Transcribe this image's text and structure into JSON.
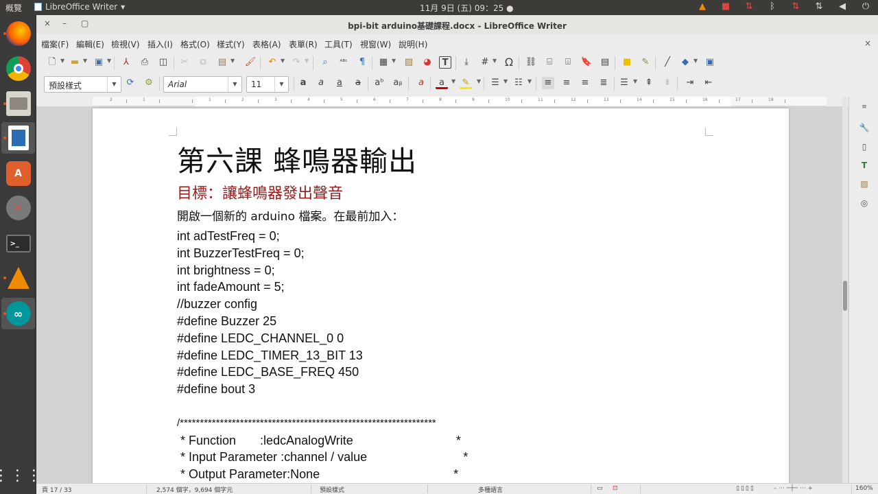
{
  "top_panel": {
    "activities": "概覽",
    "app_name": "LibreOffice Writer",
    "clock": "11月 9日 (五) 09：25"
  },
  "window": {
    "title": "bpi-bit arduino基礎課程.docx - LibreOffice Writer",
    "close": "×",
    "minimize": "–",
    "maximize": "▢"
  },
  "menubar": {
    "items": [
      "檔案(F)",
      "編輯(E)",
      "檢視(V)",
      "插入(I)",
      "格式(O)",
      "樣式(Y)",
      "表格(A)",
      "表單(R)",
      "工具(T)",
      "視窗(W)",
      "說明(H)"
    ],
    "doc_close": "×"
  },
  "toolbar": {
    "paragraph_style": "預設樣式",
    "font_name": "Arial",
    "font_size": "11"
  },
  "ruler": {
    "numbers": [
      "2",
      "1",
      "",
      "1",
      "2",
      "3",
      "4",
      "5",
      "6",
      "7",
      "8",
      "9",
      "10",
      "11",
      "12",
      "13",
      "14",
      "15",
      "16",
      "17",
      "18"
    ]
  },
  "document": {
    "heading": "第六課 蜂鳴器輸出",
    "subheading": "目標：讓蜂鳴器發出聲音",
    "intro": "開啟一個新的 arduino 檔案。在最前加入：",
    "code_lines": [
      "int adTestFreq = 0;",
      "int BuzzerTestFreq = 0;",
      "int brightness = 0;",
      "int fadeAmount = 5;",
      "//buzzer config",
      "#define Buzzer 25",
      "#define LEDC_CHANNEL_0 0",
      "#define LEDC_TIMER_13_BIT 13",
      "#define LEDC_BASE_FREQ 450",
      "#define bout 3"
    ],
    "comment_top": "/****************************************************************",
    "comment_lines": [
      " * Function       :ledcAnalogWrite                              *",
      " * Input Parameter :channel / value                            *",
      " * Output Parameter:None                                       *"
    ]
  },
  "statusbar": {
    "page": "頁 17 / 33",
    "words": "2,574 個字，9,694 個字元",
    "page_style": "預設樣式",
    "language": "多種語言",
    "zoom": "160%"
  },
  "colors": {
    "heading_red": "#9b1b1b",
    "ubuntu_orange": "#e95420"
  }
}
